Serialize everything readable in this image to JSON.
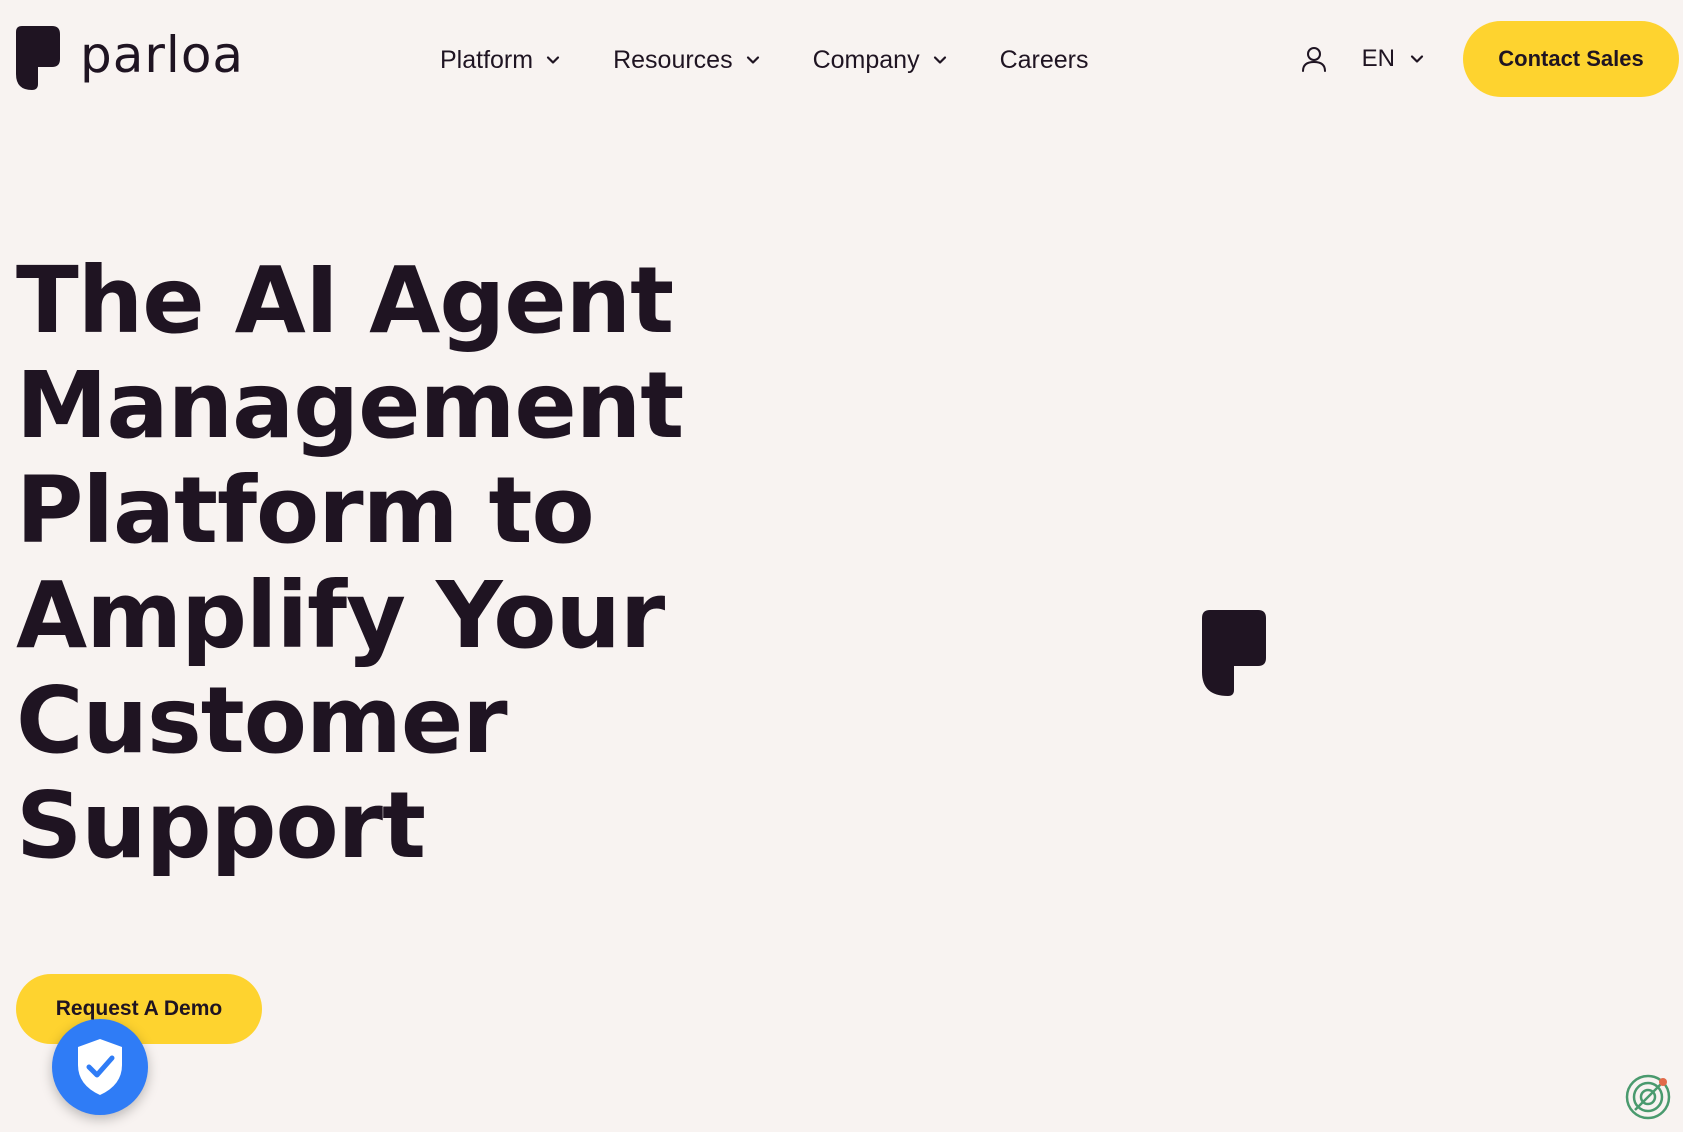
{
  "brand": {
    "name": "parloa",
    "ink_color": "#1f1422",
    "accent_color": "#fed32f",
    "background_color": "#f8f3f1",
    "logo_icon": "parloa-logo-mark"
  },
  "nav": {
    "items": [
      {
        "label": "Platform",
        "has_dropdown": true
      },
      {
        "label": "Resources",
        "has_dropdown": true
      },
      {
        "label": "Company",
        "has_dropdown": true
      },
      {
        "label": "Careers",
        "has_dropdown": false
      }
    ]
  },
  "header_actions": {
    "account_icon": "user-icon",
    "language": "EN",
    "contact_label": "Contact Sales"
  },
  "hero": {
    "title_lines": [
      "The AI Agent",
      "Management",
      "Platform to",
      "Amplify Your",
      "Customer",
      "Support"
    ],
    "cta_label": "Request A Demo",
    "center_icon": "parloa-logo-mark"
  },
  "overlays": {
    "privacy_badge_icon": "shield-check-icon",
    "privacy_badge_color": "#2f7cf6",
    "corner_widget_icon": "accessibility-widget-icon"
  }
}
